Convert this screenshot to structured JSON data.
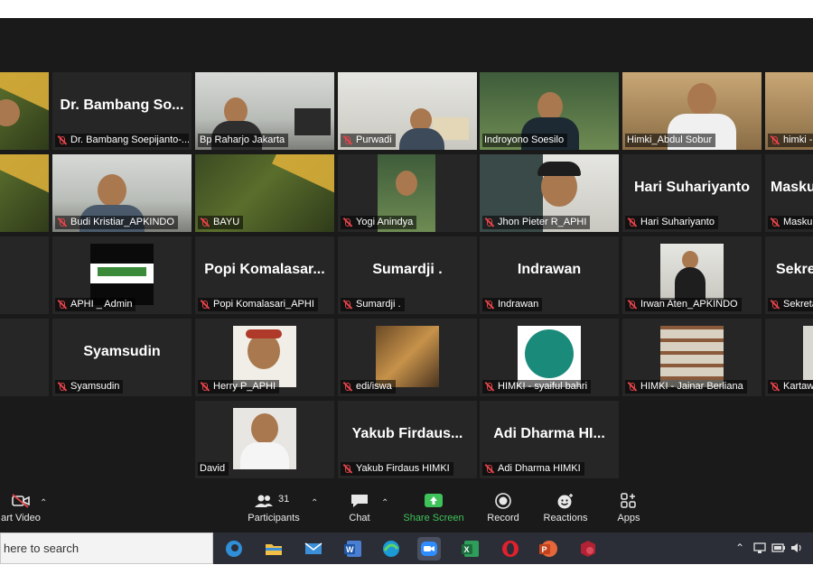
{
  "gallery": {
    "tiles": [
      {
        "name": "",
        "big": ""
      },
      {
        "name": "Dr. Bambang Soepijanto-...",
        "big": "Dr. Bambang So..."
      },
      {
        "name": "Bp Raharjo Jakarta",
        "big": ""
      },
      {
        "name": "Purwadi",
        "big": ""
      },
      {
        "name": "Indroyono Soesilo",
        "big": ""
      },
      {
        "name": "Himki_Abdul Sobur",
        "big": ""
      },
      {
        "name": "himki -",
        "big": ""
      },
      {
        "name": "",
        "big": ""
      },
      {
        "name": "Budi Kristiar_APKINDO",
        "big": ""
      },
      {
        "name": "BAYU",
        "big": ""
      },
      {
        "name": "Yogi Anindya",
        "big": ""
      },
      {
        "name": "Jhon Pieter R_APHI",
        "big": ""
      },
      {
        "name": "Hari Suhariyanto",
        "big": "Hari Suhariyanto"
      },
      {
        "name": "Masku",
        "big": "Masku"
      },
      {
        "name": "",
        "big": ""
      },
      {
        "name": "APHI _ Admin",
        "big": ""
      },
      {
        "name": "Popi Komalasari_APHI",
        "big": "Popi  Komalasar..."
      },
      {
        "name": "Sumardji .",
        "big": "Sumardji ."
      },
      {
        "name": "Indrawan",
        "big": "Indrawan"
      },
      {
        "name": "Irwan Aten_APKINDO",
        "big": ""
      },
      {
        "name": "Sekreta",
        "big": "Sekre"
      },
      {
        "name": "",
        "big": ""
      },
      {
        "name": "Syamsudin",
        "big": "Syamsudin"
      },
      {
        "name": "Herry P_APHI",
        "big": ""
      },
      {
        "name": "edi/iswa",
        "big": ""
      },
      {
        "name": "HIMKI - syaiful bahri",
        "big": ""
      },
      {
        "name": "HIMKI - Jainar Berliana",
        "big": ""
      },
      {
        "name": "Kartaw",
        "big": ""
      },
      {
        "name": "David",
        "big": ""
      },
      {
        "name": "Yakub Firdaus HIMKI",
        "big": "Yakub  Firdaus..."
      },
      {
        "name": "Adi Dharma HIMKI",
        "big": "Adi  Dharma  HI..."
      }
    ]
  },
  "toolbar": {
    "start_video": "art Video",
    "participants_label": "Participants",
    "participants_count": "31",
    "chat": "Chat",
    "share_screen": "Share Screen",
    "record": "Record",
    "reactions": "Reactions",
    "apps": "Apps"
  },
  "taskbar": {
    "search_placeholder": "here to search"
  },
  "colors": {
    "active_speaker": "#c5d43a",
    "share_green": "#3ec25a",
    "mute_red": "#e5444a"
  }
}
